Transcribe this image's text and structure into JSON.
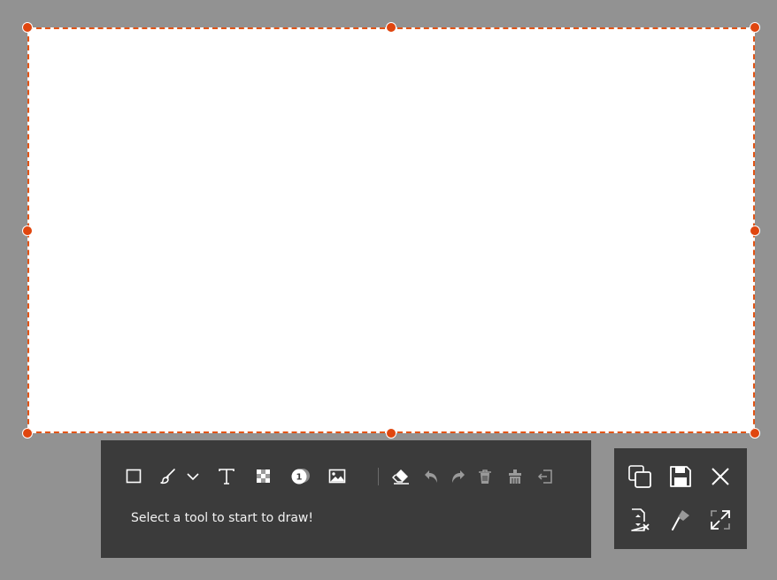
{
  "canvas": {
    "border_color": "#e25416",
    "handle_color": "#e0460f",
    "background": "#ffffff"
  },
  "toolbar": {
    "hint": "Select a tool to start to draw!",
    "counter_label": "1",
    "tools": [
      {
        "name": "rectangle-tool",
        "icon": "square-outline-icon"
      },
      {
        "name": "brush-tool",
        "icon": "paintbrush-icon"
      },
      {
        "name": "brush-options-dropdown",
        "icon": "chevron-down-icon"
      },
      {
        "name": "text-tool",
        "icon": "text-t-icon"
      },
      {
        "name": "mosaic-tool",
        "icon": "mosaic-icon"
      },
      {
        "name": "step-counter-tool",
        "icon": "numbered-circle-icon"
      },
      {
        "name": "image-tool",
        "icon": "image-icon"
      },
      {
        "name": "eraser-tool",
        "icon": "eraser-icon"
      },
      {
        "name": "undo-button",
        "icon": "undo-icon"
      },
      {
        "name": "redo-button",
        "icon": "redo-icon"
      },
      {
        "name": "delete-button",
        "icon": "trash-icon"
      },
      {
        "name": "clear-all-button",
        "icon": "brush-clear-icon"
      },
      {
        "name": "exit-edit-button",
        "icon": "exit-icon"
      }
    ]
  },
  "actions": [
    {
      "name": "copy-button",
      "icon": "copy-icon"
    },
    {
      "name": "save-button",
      "icon": "save-icon"
    },
    {
      "name": "close-button",
      "icon": "close-icon"
    },
    {
      "name": "scroll-capture-button",
      "icon": "scroll-capture-icon"
    },
    {
      "name": "pin-button",
      "icon": "pin-icon"
    },
    {
      "name": "fullscreen-button",
      "icon": "expand-icon"
    }
  ]
}
